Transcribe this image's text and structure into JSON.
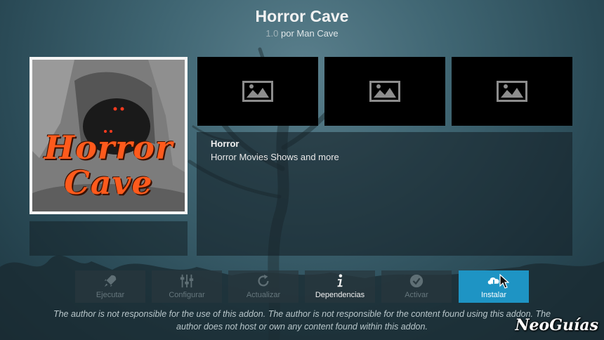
{
  "header": {
    "title": "Horror Cave",
    "version": "1.0",
    "by": "por Man Cave"
  },
  "poster": {
    "line1": "Horror",
    "line2": "Cave"
  },
  "screenshots": [
    {
      "icon": "image-placeholder-icon"
    },
    {
      "icon": "image-placeholder-icon"
    },
    {
      "icon": "image-placeholder-icon"
    }
  ],
  "description": {
    "title": "Horror",
    "text": "Horror Movies Shows and more"
  },
  "buttons": [
    {
      "label": "Ejecutar",
      "icon": "rocket-icon",
      "enabled": false
    },
    {
      "label": "Configurar",
      "icon": "sliders-icon",
      "enabled": false
    },
    {
      "label": "Actualizar",
      "icon": "refresh-icon",
      "enabled": false
    },
    {
      "label": "Dependencias",
      "icon": "info-icon",
      "enabled": true
    },
    {
      "label": "Activar",
      "icon": "check-circle-icon",
      "enabled": false
    },
    {
      "label": "Instalar",
      "icon": "cloud-download-icon",
      "enabled": true,
      "focused": true
    }
  ],
  "disclaimer": "The author is not responsible for the use of this addon. The author is not responsible for the content found using this addon. The author does not host or own any content found within this addon.",
  "watermark": "NeoGuías",
  "colors": {
    "focus": "#1e94c4",
    "background": "#3f6572",
    "accent_poster_text": "#ff5a1c"
  }
}
